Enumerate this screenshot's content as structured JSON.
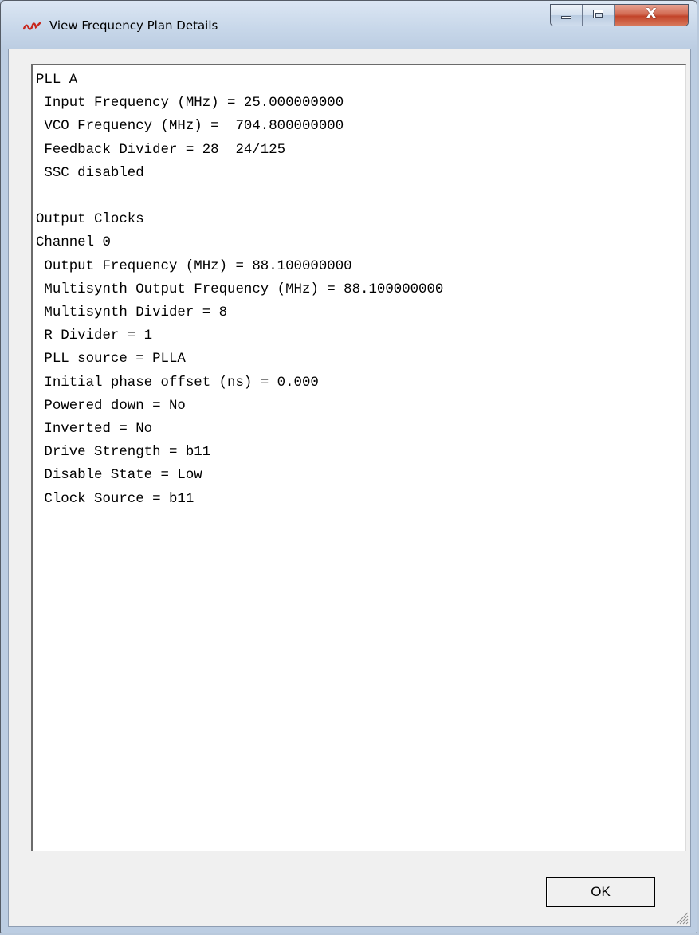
{
  "window": {
    "title": "View Frequency Plan Details",
    "icon": "app-logo-icon",
    "controls": {
      "minimize_icon": "minimize-icon",
      "maximize_icon": "maximize-icon",
      "close_label": "X"
    }
  },
  "details": {
    "lines": [
      "PLL A",
      " Input Frequency (MHz) = 25.000000000",
      " VCO Frequency (MHz) =  704.800000000",
      " Feedback Divider = 28  24/125",
      " SSC disabled",
      "",
      "Output Clocks",
      "Channel 0",
      " Output Frequency (MHz) = 88.100000000",
      " Multisynth Output Frequency (MHz) = 88.100000000",
      " Multisynth Divider = 8",
      " R Divider = 1",
      " PLL source = PLLA",
      " Initial phase offset (ns) = 0.000",
      " Powered down = No",
      " Inverted = No",
      " Drive Strength = b11",
      " Disable State = Low",
      " Clock Source = b11"
    ]
  },
  "footer": {
    "ok_label": "OK"
  },
  "colors": {
    "titlebar": "#c5d5e8",
    "close_button": "#c2442a",
    "client_bg": "#f0f0f0",
    "textarea_bg": "#ffffff",
    "app_icon": "#c8281e"
  }
}
